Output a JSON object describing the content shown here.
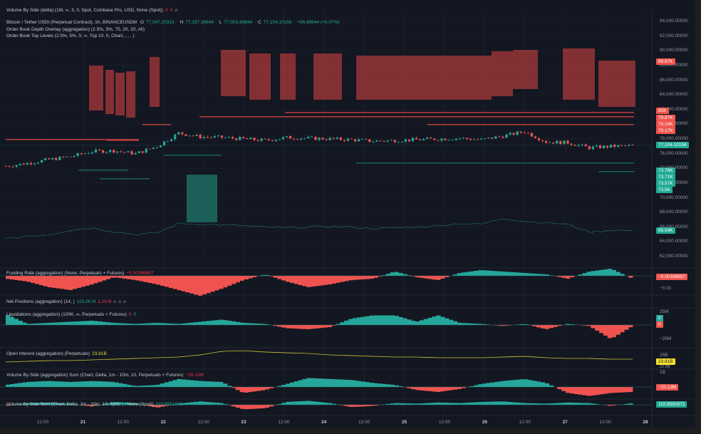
{
  "legends": {
    "vbs_delta": {
      "label": "Volume By Side (delta) (1M, ∞, 3, 0, Spot, Coinbase Pro, USD, None (Spot))",
      "v1": "0",
      "v2": "0",
      "v3": "⌀"
    },
    "symbol": {
      "label": "Bitcoin / Tether USDt (Perpetual Contract), 1h, BINANCEUSDM",
      "o_label": "O",
      "o": "77,047.20313",
      "h_label": "H",
      "h": "77,187.39844",
      "l_label": "L",
      "l": "77,003.69844",
      "c_label": "C",
      "c": "77,104.10156",
      "change": "+56.89844 (+0.07%)"
    },
    "depth_overlay": "Order Book Depth Overlay (aggregation) (2.5%, 5%, 75, 20, 20, All)",
    "top_levels": "Order Book Top Levels (2.5%, 5%, 0, ∞, Top 10, 0, Chart, , , , )",
    "funding": {
      "label": "Funding Rate (aggregation) (None, Perpetuals + Futures)",
      "value": "−0.00166857"
    },
    "net_positions": {
      "label": "Net Positions (aggregation) (14, )",
      "v1": "115.06 M",
      "v2": "1.18 B",
      "v3": "⌀",
      "v4": "⌀",
      "v5": "⌀"
    },
    "liquidations": {
      "label": "Liquidations (aggregation) (100K, ∞, Perpetuals + Futures)",
      "v1": "0",
      "v2": "0"
    },
    "open_interest": {
      "label": "Open Interest (aggregation) (Perpetuals)",
      "value": "23.81B"
    },
    "vbs_agg": {
      "label": "Volume By Side (aggregation) Sum (Chart, Delta, 1m - 10m, 10, Perpetuals + Futures)",
      "value": "−20.13M"
    },
    "vbs_sum": {
      "label": "Volume By Side Sum (Chart, Delta, 1m - 10m, 10, Spot, , , None (Spot))",
      "value": "110.8591671"
    }
  },
  "price_axis": [
    "94,000.00000",
    "92,000.00000",
    "90,000.00000",
    "88,000.00000",
    "86,000.00000",
    "84,000.00000",
    "82,000.00000",
    "80,000.00000",
    "78,000.00000",
    "76,000.00000",
    "74,000.00000",
    "72,000.00000",
    "70,000.00000",
    "68,000.00000",
    "66,000.00000",
    "64,000.00000",
    "62,000.00000"
  ],
  "price_badges": {
    "ask_top": "88.87K",
    "asks": [
      "80K",
      "79.87K",
      "79.24K",
      "79.17K"
    ],
    "last": "77,104.10156",
    "bids": [
      "73.78K",
      "73.71K",
      "73.57K",
      "73.5K"
    ],
    "bid_low": "65.54K"
  },
  "sub_axis": {
    "funding_value": "−0.00166857",
    "funding_tick": "−0.01",
    "liq_top": "25M",
    "liq_green": "0",
    "liq_red": "0",
    "liq_bottom": "−25M",
    "oi_top": "25B",
    "oi_value": "23.81B",
    "oi_mid": "22.5B",
    "oi_low": "1B",
    "vbs_agg_value": "−20.13M",
    "vbs_sum_value": "110.8591671"
  },
  "time_axis": [
    {
      "t": "12:00",
      "day": false
    },
    {
      "t": "21",
      "day": true
    },
    {
      "t": "12:00",
      "day": false
    },
    {
      "t": "22",
      "day": true
    },
    {
      "t": "12:00",
      "day": false
    },
    {
      "t": "23",
      "day": true
    },
    {
      "t": "12:00",
      "day": false
    },
    {
      "t": "24",
      "day": true
    },
    {
      "t": "12:00",
      "day": false
    },
    {
      "t": "25",
      "day": true
    },
    {
      "t": "12:00",
      "day": false
    },
    {
      "t": "26",
      "day": true
    },
    {
      "t": "12:00",
      "day": false
    },
    {
      "t": "27",
      "day": true
    },
    {
      "t": "12:00",
      "day": false
    },
    {
      "t": "28",
      "day": true
    }
  ],
  "colors": {
    "up": "#26a69a",
    "down": "#ef5350",
    "bg": "#131722",
    "grid": "#1f2330",
    "oi": "#c9c236"
  },
  "chart_data": {
    "type": "line",
    "price_anchors": [
      74300,
      74700,
      75200,
      75600,
      76300,
      76400,
      76000,
      77000,
      78800,
      78300,
      78200,
      78000,
      77800,
      78200,
      78100,
      78000,
      77900,
      77700,
      77800,
      77900,
      78000,
      78100,
      77900,
      78400,
      79000,
      77600,
      77500,
      76800,
      77000,
      77100
    ],
    "bid_depth_line": [
      64400,
      64800,
      65000,
      65600,
      65900,
      65400,
      65000,
      65200,
      66500,
      66400,
      66300,
      66200,
      66000,
      65900,
      66000,
      66100,
      66000,
      65800,
      65900,
      66000,
      66200,
      66500,
      66400,
      67200,
      66800,
      66600,
      66400,
      65300,
      65600,
      65500
    ],
    "funding": [
      -0.2,
      -0.4,
      -0.8,
      -1.0,
      -0.6,
      -0.1,
      -0.3,
      -0.6,
      -1.0,
      -1.4,
      -0.9,
      -0.3,
      0.1,
      -0.4,
      -0.8,
      -0.6,
      -0.3,
      -0.2,
      0.3,
      -0.1,
      -0.3,
      0.2,
      0.4,
      0.3,
      0.2,
      0.1,
      -0.2,
      0.3,
      0.5,
      -0.2
    ],
    "liquidations": [
      1.0,
      0.1,
      0.2,
      0.3,
      0.4,
      0.2,
      0.1,
      0.2,
      0.1,
      0.3,
      0.5,
      0.2,
      0.1,
      -0.3,
      -0.4,
      -0.2,
      0.6,
      0.9,
      0.9,
      0.3,
      0.9,
      0.2,
      0.1,
      -0.1,
      0.1,
      -0.4,
      0.1,
      -0.1,
      -1.3,
      -0.1
    ],
    "open_interest": [
      0.2,
      0.25,
      0.3,
      0.3,
      0.35,
      0.4,
      0.45,
      0.5,
      0.55,
      0.7,
      0.95,
      1.0,
      0.9,
      0.85,
      0.8,
      0.7,
      0.65,
      0.6,
      0.55,
      0.55,
      0.5,
      0.5,
      0.5,
      0.55,
      0.6,
      0.5,
      0.45,
      0.45,
      0.4,
      0.4
    ],
    "vbs_agg": [
      0.2,
      0.5,
      0.6,
      0.5,
      0.6,
      0.5,
      0.1,
      0.2,
      0.8,
      0.6,
      0.5,
      -0.6,
      -0.3,
      0.3,
      0.9,
      0.8,
      0.7,
      0.4,
      0.2,
      -0.3,
      -0.5,
      -0.2,
      0.3,
      0.6,
      0.8,
      0.4,
      -0.6,
      -0.9,
      -0.6,
      -0.5
    ],
    "vbs_sum": [
      -0.2,
      0.3,
      0.4,
      0.2,
      -0.3,
      0.5,
      0.3,
      -0.5,
      0.2,
      0.6,
      0.3,
      -0.8,
      -0.6,
      0.5,
      0.7,
      0.3,
      -0.4,
      -0.2,
      0.3,
      0.2,
      0.4,
      0.3,
      0.5,
      0.6,
      0.3,
      0.2,
      0.4,
      0.3,
      -0.2,
      0.3
    ]
  }
}
